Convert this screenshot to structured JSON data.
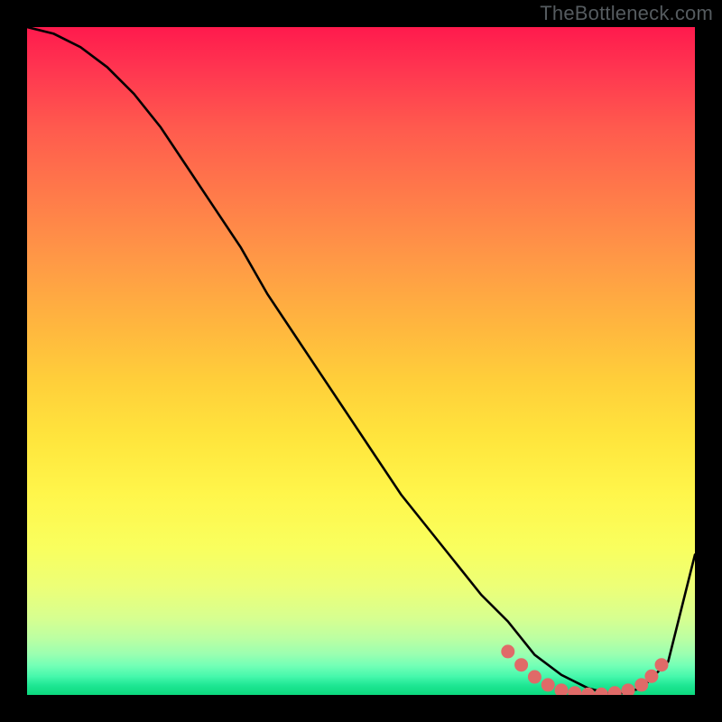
{
  "watermark": "TheBottleneck.com",
  "chart_data": {
    "type": "line",
    "title": "",
    "xlabel": "",
    "ylabel": "",
    "xlim": [
      0,
      100
    ],
    "ylim": [
      0,
      100
    ],
    "series": [
      {
        "name": "curve",
        "x": [
          0,
          4,
          8,
          12,
          16,
          20,
          24,
          28,
          32,
          36,
          40,
          44,
          48,
          52,
          56,
          60,
          64,
          68,
          72,
          76,
          80,
          84,
          88,
          92,
          96,
          100
        ],
        "y": [
          100,
          99,
          97,
          94,
          90,
          85,
          79,
          73,
          67,
          60,
          54,
          48,
          42,
          36,
          30,
          25,
          20,
          15,
          11,
          6,
          3,
          1,
          0,
          1,
          5,
          21
        ]
      }
    ],
    "markers": {
      "color": "#e06a68",
      "points": [
        {
          "x": 72,
          "y": 6.5
        },
        {
          "x": 74,
          "y": 4.5
        },
        {
          "x": 76,
          "y": 2.7
        },
        {
          "x": 78,
          "y": 1.5
        },
        {
          "x": 80,
          "y": 0.7
        },
        {
          "x": 82,
          "y": 0.3
        },
        {
          "x": 84,
          "y": 0.1
        },
        {
          "x": 86,
          "y": 0.1
        },
        {
          "x": 88,
          "y": 0.3
        },
        {
          "x": 90,
          "y": 0.7
        },
        {
          "x": 92,
          "y": 1.5
        },
        {
          "x": 93.5,
          "y": 2.8
        },
        {
          "x": 95,
          "y": 4.5
        }
      ]
    }
  },
  "colors": {
    "marker": "#e06a68",
    "line": "#000000"
  }
}
